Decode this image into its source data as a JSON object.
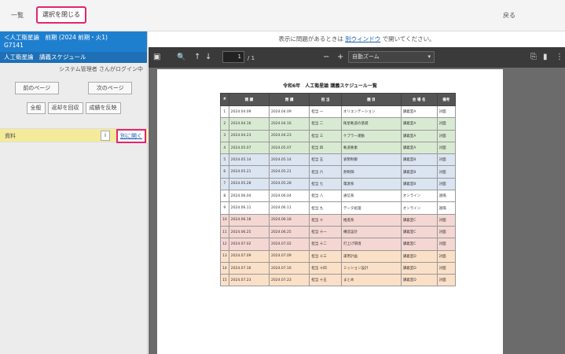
{
  "top_tabs": [
    "一覧",
    "選択を閉じる",
    "戻る"
  ],
  "left_panel": {
    "header_line1": "＜人工衛星論　前期 (2024 前期・火1)",
    "header_line2": "G7141",
    "header_line3": "人工衛星論　講義スケジュール",
    "system_line": "システム管理者 さんがログイン中",
    "prev_page": "前のページ",
    "next_page": "次のページ",
    "buttons": [
      "全般",
      "返却を回収",
      "成績を反映"
    ],
    "selected_label": "資料",
    "small_button": "i",
    "open_button": "別に開く"
  },
  "notice": {
    "prefix": "表示に問題があるときは ",
    "link": "別ウィンドウ",
    "suffix": " で開いてください。"
  },
  "toolbar": {
    "sidebar_icon": "▣",
    "search_icon": "🔍",
    "up_icon": "↑",
    "down_icon": "↓",
    "page_current": "1",
    "page_total": "/ 1",
    "zoom_out": "−",
    "zoom_in": "+",
    "zoom_value": "自動ズーム",
    "open_icon": "⎘",
    "print_icon": "▮",
    "more_icon": "⋮"
  },
  "document": {
    "title": "令和6年　人工衛星論 講義スケジュール一覧",
    "headers": [
      "#",
      "開 講",
      "閉 講",
      "担 当",
      "題 目",
      "会 場 名",
      "備考"
    ],
    "rows": [
      {
        "no": "1",
        "c1": "2024.04.09",
        "c2": "2024.04.09",
        "c3": "担当 一",
        "c4": "オリエンテーション",
        "c5": "講義室A",
        "c6": "対面",
        "group": "white"
      },
      {
        "no": "2",
        "c1": "2024.04.16",
        "c2": "2024.04.16",
        "c3": "担当 二",
        "c4": "衛星軌道の基礎",
        "c5": "講義室A",
        "c6": "対面",
        "group": "green"
      },
      {
        "no": "3",
        "c1": "2024.04.23",
        "c2": "2024.04.23",
        "c3": "担当 三",
        "c4": "ケプラー運動",
        "c5": "講義室A",
        "c6": "対面",
        "group": "green"
      },
      {
        "no": "4",
        "c1": "2024.05.07",
        "c2": "2024.05.07",
        "c3": "担当 四",
        "c4": "軌道要素",
        "c5": "講義室A",
        "c6": "対面",
        "group": "green"
      },
      {
        "no": "5",
        "c1": "2024.05.14",
        "c2": "2024.05.14",
        "c3": "担当 五",
        "c4": "姿勢制御",
        "c5": "講義室B",
        "c6": "対面",
        "group": "blue"
      },
      {
        "no": "6",
        "c1": "2024.05.21",
        "c2": "2024.05.21",
        "c3": "担当 六",
        "c4": "熱制御",
        "c5": "講義室B",
        "c6": "対面",
        "group": "blue"
      },
      {
        "no": "7",
        "c1": "2024.05.28",
        "c2": "2024.05.28",
        "c3": "担当 七",
        "c4": "電源系",
        "c5": "講義室B",
        "c6": "対面",
        "group": "blue"
      },
      {
        "no": "8",
        "c1": "2024.06.04",
        "c2": "2024.06.04",
        "c3": "担当 八",
        "c4": "通信系",
        "c5": "オンライン",
        "c6": "遠隔",
        "group": "white"
      },
      {
        "no": "9",
        "c1": "2024.06.11",
        "c2": "2024.06.11",
        "c3": "担当 九",
        "c4": "データ処理",
        "c5": "オンライン",
        "c6": "遠隔",
        "group": "white"
      },
      {
        "no": "10",
        "c1": "2024.06.18",
        "c2": "2024.06.18",
        "c3": "担当 十",
        "c4": "推進系",
        "c5": "講義室C",
        "c6": "対面",
        "group": "pink"
      },
      {
        "no": "11",
        "c1": "2024.06.25",
        "c2": "2024.06.25",
        "c3": "担当 十一",
        "c4": "構造設計",
        "c5": "講義室C",
        "c6": "対面",
        "group": "pink"
      },
      {
        "no": "12",
        "c1": "2024.07.02",
        "c2": "2024.07.02",
        "c3": "担当 十二",
        "c4": "打上げ環境",
        "c5": "講義室C",
        "c6": "対面",
        "group": "pink"
      },
      {
        "no": "13",
        "c1": "2024.07.09",
        "c2": "2024.07.09",
        "c3": "担当 十三",
        "c4": "運用計画",
        "c5": "講義室D",
        "c6": "対面",
        "group": "orange"
      },
      {
        "no": "14",
        "c1": "2024.07.16",
        "c2": "2024.07.16",
        "c3": "担当 十四",
        "c4": "ミッション設計",
        "c5": "講義室D",
        "c6": "対面",
        "group": "orange"
      },
      {
        "no": "15",
        "c1": "2024.07.23",
        "c2": "2024.07.23",
        "c3": "担当 十五",
        "c4": "まとめ",
        "c5": "講義室D",
        "c6": "対面",
        "group": "orange"
      }
    ]
  }
}
